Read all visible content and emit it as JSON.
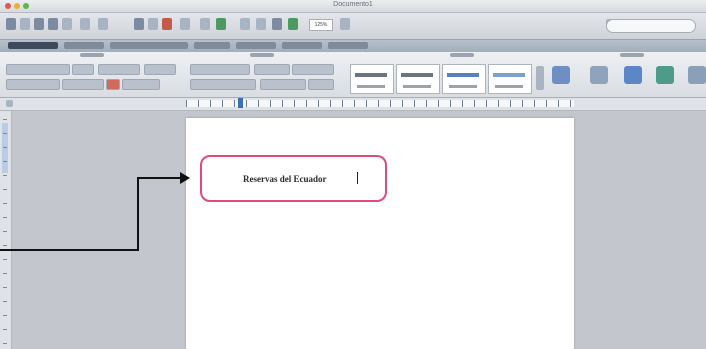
{
  "window": {
    "title": "Documento1"
  },
  "toolbar": {
    "zoom_value": "125%"
  },
  "document": {
    "text": "Reservas del Ecuador"
  },
  "annotation": {
    "highlight_color": "#e04a7a",
    "arrow_color": "#111111"
  }
}
